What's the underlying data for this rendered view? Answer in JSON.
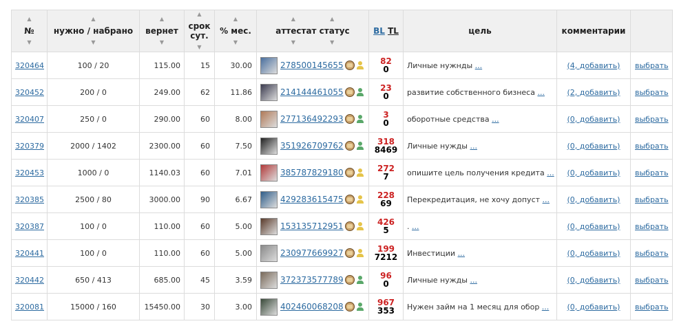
{
  "headers": {
    "num": "№",
    "need": "нужно / набрано",
    "returns": "вернет",
    "term_line1": "срок",
    "term_line2": "сут.",
    "pct": "% мес.",
    "attest": "аттестат статус",
    "bl": "BL",
    "tl": "TL",
    "goal": "цель",
    "comments": "комментарии"
  },
  "rows": [
    {
      "id": "320464",
      "need": "100 / 20",
      "returns": "115.00",
      "term": "15",
      "pct": "30.00",
      "wmid": "278500145655",
      "bl": "82",
      "tl": "0",
      "goal": "Личные нужнды",
      "more": "...",
      "comments": "(4, добавить)",
      "choose": "выбрать",
      "avatar_color": "#4a6f9e",
      "badge_color": "yellow"
    },
    {
      "id": "320452",
      "need": "200 / 0",
      "returns": "249.00",
      "term": "62",
      "pct": "11.86",
      "wmid": "214144461055",
      "bl": "23",
      "tl": "0",
      "goal": "развитие собственного бизнеса",
      "more": "...",
      "comments": "(2, добавить)",
      "choose": "выбрать",
      "avatar_color": "#3b3b4f",
      "badge_color": "green"
    },
    {
      "id": "320407",
      "need": "250 / 0",
      "returns": "290.00",
      "term": "60",
      "pct": "8.00",
      "wmid": "277136492293",
      "bl": "3",
      "tl": "0",
      "goal": "оборотные средства",
      "more": "...",
      "comments": "(0, добавить)",
      "choose": "выбрать",
      "avatar_color": "#b07a58",
      "badge_color": "green"
    },
    {
      "id": "320379",
      "need": "2000 / 1402",
      "returns": "2300.00",
      "term": "60",
      "pct": "7.50",
      "wmid": "351926709762",
      "bl": "318",
      "tl": "8469",
      "goal": "Личные нужды",
      "more": "...",
      "comments": "(0, добавить)",
      "choose": "выбрать",
      "avatar_color": "#222222",
      "badge_color": "green"
    },
    {
      "id": "320453",
      "need": "1000 / 0",
      "returns": "1140.03",
      "term": "60",
      "pct": "7.01",
      "wmid": "385787829180",
      "bl": "272",
      "tl": "7",
      "goal": "опишите цель получения кредита",
      "more": "...",
      "comments": "(0, добавить)",
      "choose": "выбрать",
      "avatar_color": "#b23a3a",
      "badge_color": "yellow"
    },
    {
      "id": "320385",
      "need": "2500 / 80",
      "returns": "3000.00",
      "term": "90",
      "pct": "6.67",
      "wmid": "429283615475",
      "bl": "228",
      "tl": "69",
      "goal": "Перекредитация, не хочу допуст",
      "more": "...",
      "comments": "(0, добавить)",
      "choose": "выбрать",
      "avatar_color": "#2f5d8a",
      "badge_color": "yellow"
    },
    {
      "id": "320387",
      "need": "100 / 0",
      "returns": "110.00",
      "term": "60",
      "pct": "5.00",
      "wmid": "153135712951",
      "bl": "426",
      "tl": "5",
      "goal": ".",
      "more": "...",
      "comments": "(0, добавить)",
      "choose": "выбрать",
      "avatar_color": "#5a3b2b",
      "badge_color": "yellow"
    },
    {
      "id": "320441",
      "need": "100 / 0",
      "returns": "110.00",
      "term": "60",
      "pct": "5.00",
      "wmid": "230977669927",
      "bl": "199",
      "tl": "7212",
      "goal": "Инвестиции",
      "more": "...",
      "comments": "(0, добавить)",
      "choose": "выбрать",
      "avatar_color": "#8a8a8a",
      "badge_color": "yellow"
    },
    {
      "id": "320442",
      "need": "650 / 413",
      "returns": "685.00",
      "term": "45",
      "pct": "3.59",
      "wmid": "372373577789",
      "bl": "96",
      "tl": "0",
      "goal": "Личные нужды",
      "more": "...",
      "comments": "(0, добавить)",
      "choose": "выбрать",
      "avatar_color": "#7a6a5a",
      "badge_color": "green"
    },
    {
      "id": "320081",
      "need": "15000 / 160",
      "returns": "15450.00",
      "term": "30",
      "pct": "3.00",
      "wmid": "402460068208",
      "bl": "967",
      "tl": "353",
      "goal": "Нужен займ на 1 месяц для обор",
      "more": "...",
      "comments": "(0, добавить)",
      "choose": "выбрать",
      "avatar_color": "#3a4a3a",
      "badge_color": "green"
    }
  ]
}
